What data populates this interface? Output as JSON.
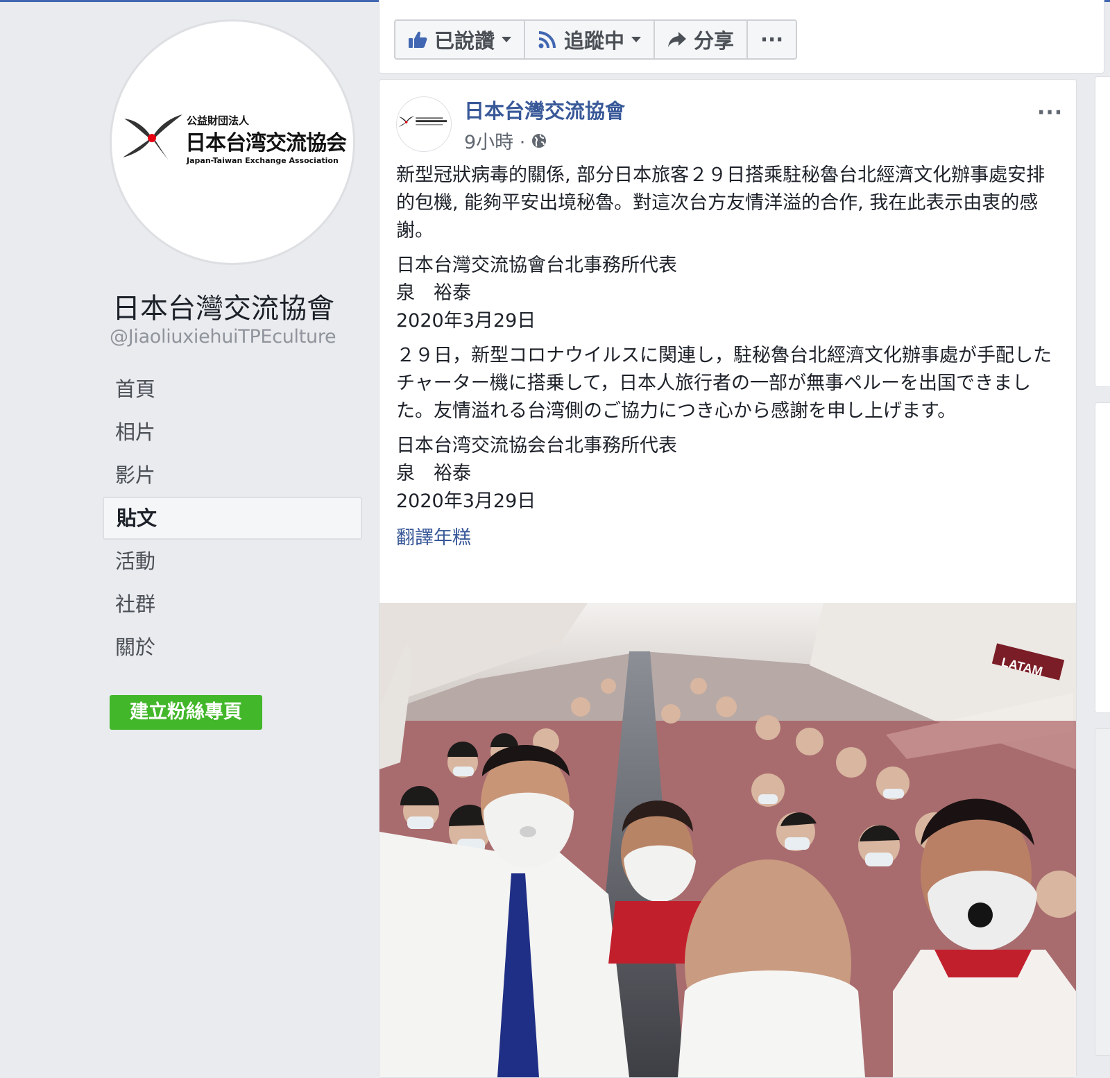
{
  "page": {
    "name": "日本台灣交流協會",
    "handle": "@JiaoliuxiehuiTPEculture",
    "logo": {
      "sub": "公益財団法人",
      "main": "日本台湾交流協会",
      "en": "Japan-Taiwan Exchange Association"
    }
  },
  "nav": {
    "items": [
      {
        "label": "首頁"
      },
      {
        "label": "相片"
      },
      {
        "label": "影片"
      },
      {
        "label": "貼文"
      },
      {
        "label": "活動"
      },
      {
        "label": "社群"
      },
      {
        "label": "關於"
      }
    ],
    "active": "貼文",
    "create_page": "建立粉絲專頁"
  },
  "actions": {
    "liked": "已說讚",
    "following": "追蹤中",
    "share": "分享",
    "more": "···"
  },
  "post": {
    "author": "日本台灣交流協會",
    "time": "9小時 ·",
    "privacy_icon": "globe-icon",
    "more": "···",
    "paragraphs": [
      "新型冠狀病毒的關係, 部分日本旅客２９日搭乘駐秘魯台北經濟文化辦事處安排的包機, 能夠平安出境秘魯。對這次台方友情洋溢的合作, 我在此表示由衷的感謝。",
      "日本台灣交流協會台北事務所代表\n泉　裕泰\n2020年3月29日",
      "２９日，新型コロナウイルスに関連し，駐秘魯台北經濟文化辦事處が手配したチャーター機に搭乗して，日本人旅行者の一部が無事ペルーを出国できました。友情溢れる台湾側のご協力につき心から感謝を申し上げます。",
      "日本台湾交流協会台北事務所代表\n泉　裕泰\n2020年3月29日"
    ],
    "translate": "翻譯年糕",
    "photo_sign": "LATAM"
  },
  "colors": {
    "link": "#385898",
    "create": "#42b72a",
    "bg": "#e9ebee"
  }
}
